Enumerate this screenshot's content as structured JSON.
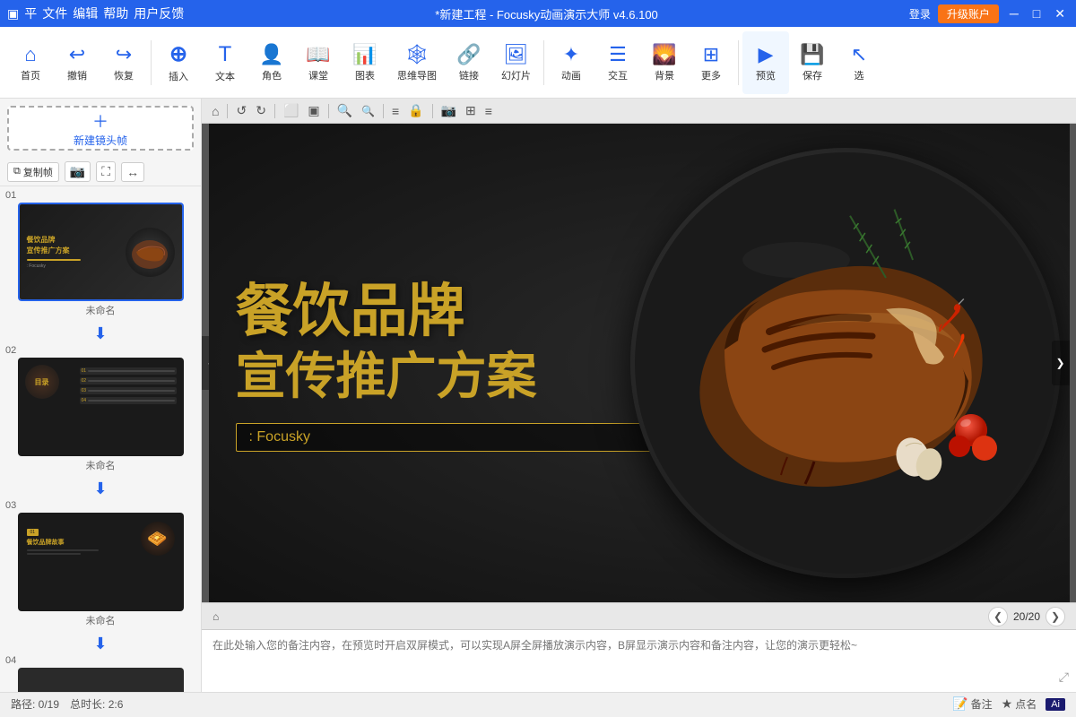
{
  "titleBar": {
    "appIcon": "▣",
    "menuItems": [
      "平",
      "文件",
      "编辑",
      "帮助",
      "用户反馈"
    ],
    "title": "*新建工程 - Focusky动画演示大师  v4.6.100",
    "loginLabel": "登录",
    "upgradeLabel": "升级账户",
    "minBtn": "─",
    "maxBtn": "□",
    "closeBtn": "✕"
  },
  "toolbar": {
    "groups": [
      {
        "id": "home",
        "icon": "⌂",
        "label": "首页"
      },
      {
        "id": "undo",
        "icon": "↩",
        "label": "撤销"
      },
      {
        "id": "redo",
        "icon": "↪",
        "label": "恢复"
      },
      {
        "id": "insert",
        "icon": "+",
        "label": "插入"
      },
      {
        "id": "text",
        "icon": "T",
        "label": "文本"
      },
      {
        "id": "role",
        "icon": "👤",
        "label": "角色"
      },
      {
        "id": "class",
        "icon": "📖",
        "label": "课堂"
      },
      {
        "id": "chart",
        "icon": "📊",
        "label": "图表"
      },
      {
        "id": "mindmap",
        "icon": "🔗",
        "label": "思维导图"
      },
      {
        "id": "link",
        "icon": "🔗",
        "label": "链接"
      },
      {
        "id": "slide",
        "icon": "□",
        "label": "幻灯片"
      },
      {
        "id": "animation",
        "icon": "✦",
        "label": "动画"
      },
      {
        "id": "interact",
        "icon": "☰",
        "label": "交互"
      },
      {
        "id": "bg",
        "icon": "🖼",
        "label": "背景"
      },
      {
        "id": "more",
        "icon": "≡",
        "label": "更多"
      },
      {
        "id": "preview",
        "icon": "▶",
        "label": "预览"
      },
      {
        "id": "save",
        "icon": "💾",
        "label": "保存"
      },
      {
        "id": "select",
        "icon": "↖",
        "label": "选"
      }
    ]
  },
  "slidePanel": {
    "newFrameBtn": "新建镜头帧",
    "copyBtn": "复制帧",
    "slides": [
      {
        "number": "01",
        "name": "未命名",
        "active": true
      },
      {
        "number": "02",
        "name": "未命名",
        "active": false
      },
      {
        "number": "03",
        "name": "未命名",
        "active": false
      },
      {
        "number": "04",
        "name": "",
        "active": false
      }
    ]
  },
  "canvas": {
    "slide": {
      "mainTitle": "餐饮品牌",
      "subTitle": "宣传推广方案",
      "titleLine1": "餐饮品牌",
      "titleLine2": "宣传推广方案",
      "brandLabel": ": Focusky",
      "pageInfo": "20/20"
    }
  },
  "notes": {
    "placeholder": "在此处输入您的备注内容，在预览时开启双屏模式，可以实现A屏全屏播放演示内容，B屏显示演示内容和备注内容，让您的演示更轻松~"
  },
  "statusBar": {
    "path": "路径: 0/19",
    "duration": "总时长: 2:6",
    "notesBtnLabel": "备注",
    "pointsBtnLabel": "点名",
    "aiLabel": "Ai"
  },
  "canvasToolbar": {
    "icons": [
      "⌂",
      "↺",
      "↻",
      "□",
      "□",
      "🔍+",
      "🔍-",
      "≡",
      "🔒",
      "📷",
      "⊞",
      "≡"
    ]
  }
}
